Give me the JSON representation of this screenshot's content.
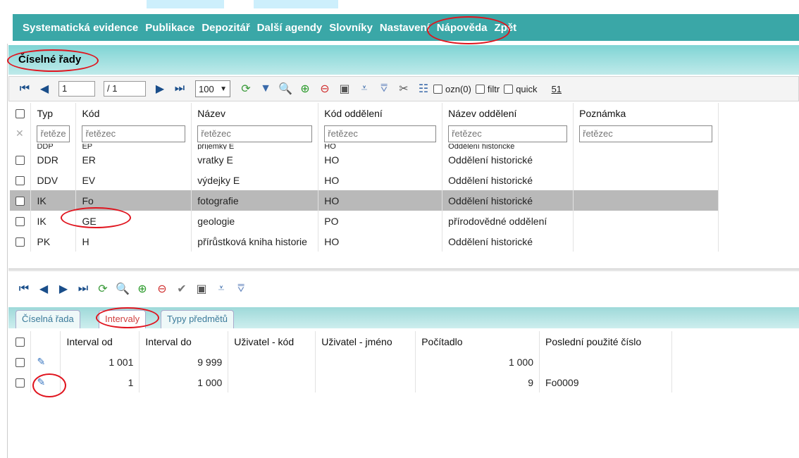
{
  "menu": [
    "Systematická evidence",
    "Publikace",
    "Depozitář",
    "Další agendy",
    "Slovníky",
    "Nastavení",
    "Nápověda",
    "Zpět"
  ],
  "title": "Číselné řady",
  "pager": {
    "page": "1",
    "of": "/ 1",
    "page_size": "100",
    "ozn": "ozn(0)",
    "filtr": "filtr",
    "quick": "quick",
    "count": "51"
  },
  "grid": {
    "headers": [
      "Typ",
      "Kód",
      "Název",
      "Kód oddělení",
      "Název oddělení",
      "Poznámka"
    ],
    "filter_placeholder": "řetězec",
    "filter_placeholder_short": "řetěze",
    "partial_row": [
      "DDP",
      "EP",
      "příjemky E",
      "HO",
      "Oddělení historické",
      ""
    ],
    "rows": [
      [
        "DDR",
        "ER",
        "vratky E",
        "HO",
        "Oddělení historické",
        ""
      ],
      [
        "DDV",
        "EV",
        "výdejky E",
        "HO",
        "Oddělení historické",
        ""
      ],
      [
        "IK",
        "Fo",
        "fotografie",
        "HO",
        "Oddělení historické",
        ""
      ],
      [
        "IK",
        "GE",
        "geologie",
        "PO",
        "přírodovědné oddělení",
        ""
      ],
      [
        "PK",
        "H",
        "přírůstková kniha historie",
        "HO",
        "Oddělení historické",
        ""
      ]
    ],
    "selected_index": 2
  },
  "tabs": [
    "Číselná řada",
    "Intervaly",
    "Typy předmětů"
  ],
  "active_tab": 1,
  "intervals": {
    "headers": [
      "Interval od",
      "Interval do",
      "Uživatel - kód",
      "Uživatel - jméno",
      "Počítadlo",
      "Poslední použité číslo"
    ],
    "rows": [
      [
        "1 001",
        "9 999",
        "",
        "",
        "1 000",
        ""
      ],
      [
        "1",
        "1 000",
        "",
        "",
        "9",
        "Fo0009"
      ]
    ]
  },
  "colors": {
    "menu_bg": "#3aa7a7",
    "title_bg": "#9fdfdf",
    "highlight_circle": "#e0141e",
    "selected_row": "#b9b9b9"
  }
}
